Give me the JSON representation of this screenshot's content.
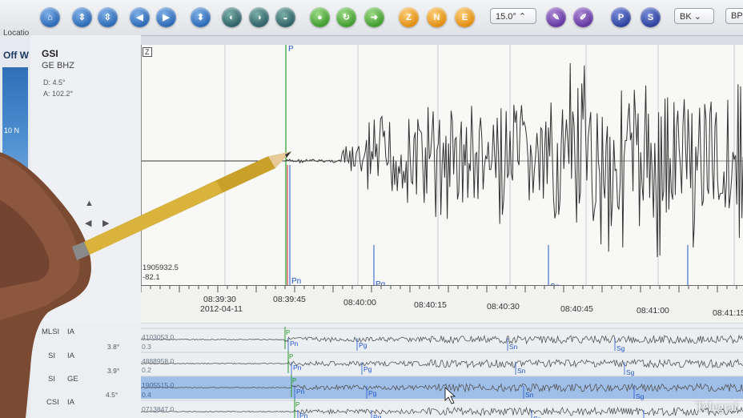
{
  "toolbar": {
    "buttons": [
      {
        "name": "home",
        "color": "blue",
        "glyph": "⌂"
      },
      {
        "name": "zoom-in-vertical",
        "color": "blue",
        "glyph": "⇕"
      },
      {
        "name": "zoom-out-vertical",
        "color": "blue",
        "glyph": "⇳"
      },
      {
        "name": "previous",
        "color": "blue",
        "glyph": "◀"
      },
      {
        "name": "next",
        "color": "blue",
        "glyph": "▶"
      },
      {
        "name": "up",
        "color": "blue",
        "glyph": "⬍"
      },
      {
        "name": "filter-1",
        "color": "teal",
        "glyph": "◐"
      },
      {
        "name": "filter-2",
        "color": "teal",
        "glyph": "◑"
      },
      {
        "name": "filter-3",
        "color": "teal",
        "glyph": "◒"
      },
      {
        "name": "record",
        "color": "green",
        "glyph": "●"
      },
      {
        "name": "reload",
        "color": "green",
        "glyph": "↻"
      },
      {
        "name": "forward",
        "color": "green",
        "glyph": "➜"
      },
      {
        "name": "component-z",
        "color": "orange",
        "glyph": "Z"
      },
      {
        "name": "component-n",
        "color": "orange",
        "glyph": "N"
      },
      {
        "name": "component-e",
        "color": "orange",
        "glyph": "E"
      },
      {
        "name": "tool-1",
        "color": "purple",
        "glyph": "✎"
      },
      {
        "name": "tool-2",
        "color": "purple",
        "glyph": "✐"
      },
      {
        "name": "pick-p",
        "color": "navy",
        "glyph": "P"
      },
      {
        "name": "pick-s",
        "color": "navy",
        "glyph": "S"
      }
    ],
    "timewindow_value": "15.0°",
    "filter_value": "BK",
    "bp_value": "BP"
  },
  "left": {
    "location_label": "Locatio",
    "off_label": "Off W",
    "lat_label": "10 N"
  },
  "station": {
    "name": "GSI",
    "code": "GE BHZ",
    "distance": "D: 4.5°",
    "azimuth": "A: 102.2°",
    "component_tag": "Z",
    "amp_max": "1905932.5",
    "amp_min": "-82.1"
  },
  "axis": {
    "date": "2012-04-11",
    "ticks": [
      "08:39:30",
      "08:39:45",
      "08:40:00",
      "08:40:15",
      "08:40:30",
      "08:40:45",
      "08:41:00",
      "08:41:15"
    ]
  },
  "picks_main": {
    "p": "P",
    "pn": "Pn",
    "pg": "Pg",
    "sn": "Sn",
    "sg": "Sg"
  },
  "rows": [
    {
      "station": "MLSI",
      "net": "IA",
      "dist": "",
      "amp": "4103053.0",
      "amp2": "0.3"
    },
    {
      "station": "SI",
      "net": "IA",
      "dist": "3.8°",
      "amp": "4888958.0",
      "amp2": "0.2"
    },
    {
      "station": "SI",
      "net": "GE",
      "dist": "3.9°",
      "amp": "1905515.0",
      "amp2": "0.4"
    },
    {
      "station": "CSI",
      "net": "IA",
      "dist": "4.5°",
      "amp": "0713847.0",
      "amp2": ""
    }
  ],
  "watermark": "Telegraf",
  "colors": {
    "trace": "#333333",
    "pick_blue": "#2255cc",
    "pick_green": "#2a9a2a",
    "pick_red": "#cc2222",
    "selected_row": "#9fbfe8"
  }
}
